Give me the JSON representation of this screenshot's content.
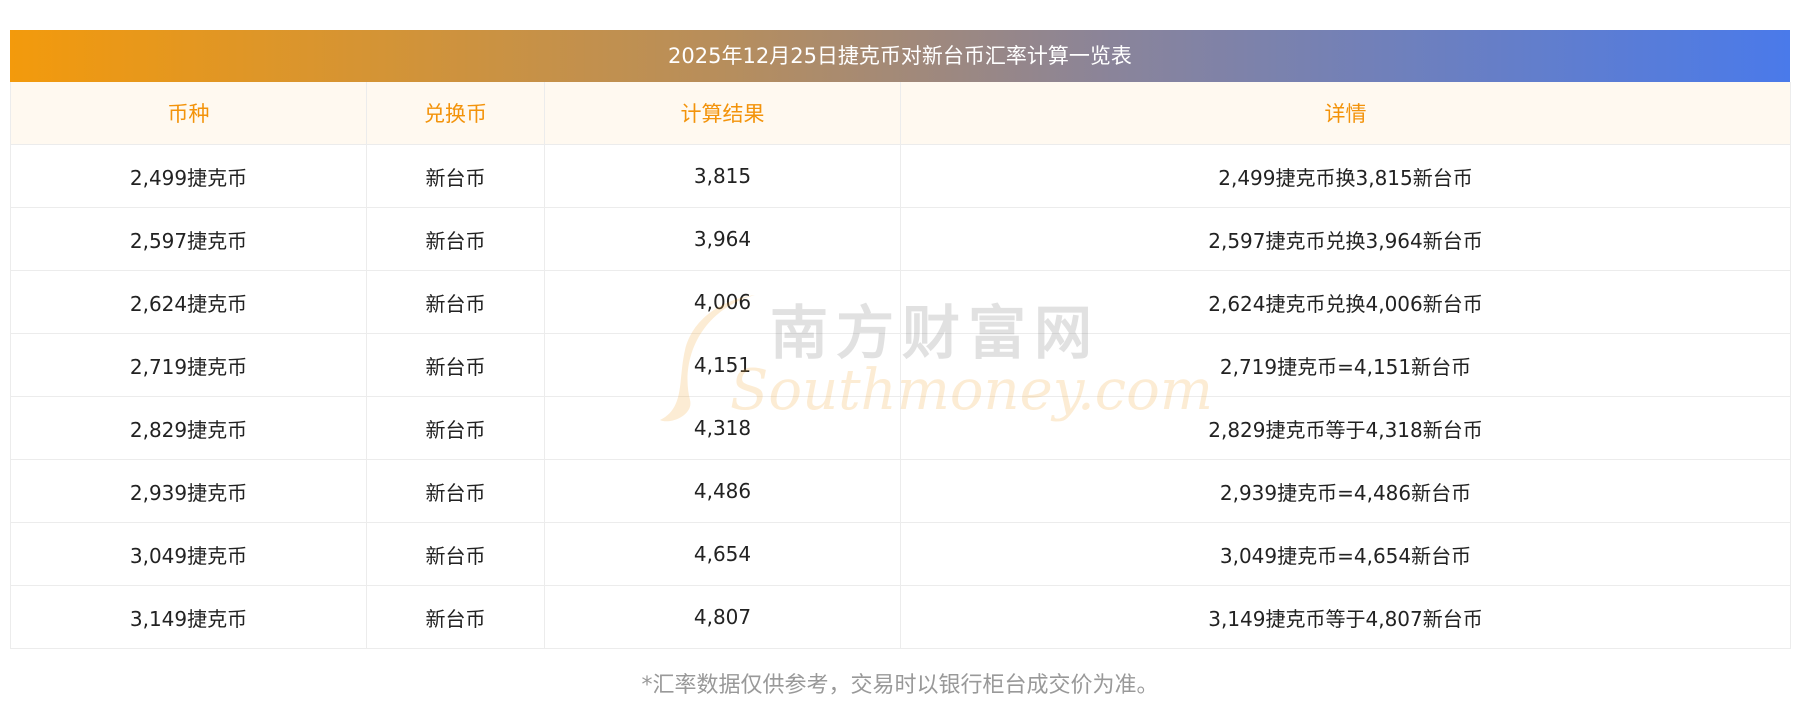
{
  "title": "2025年12月25日捷克币对新台币汇率计算一览表",
  "headers": [
    "币种",
    "兑换币",
    "计算结果",
    "详情"
  ],
  "rows": [
    [
      "2,499捷克币",
      "新台币",
      "3,815",
      "2,499捷克币换3,815新台币"
    ],
    [
      "2,597捷克币",
      "新台币",
      "3,964",
      "2,597捷克币兑换3,964新台币"
    ],
    [
      "2,624捷克币",
      "新台币",
      "4,006",
      "2,624捷克币兑换4,006新台币"
    ],
    [
      "2,719捷克币",
      "新台币",
      "4,151",
      "2,719捷克币=4,151新台币"
    ],
    [
      "2,829捷克币",
      "新台币",
      "4,318",
      "2,829捷克币等于4,318新台币"
    ],
    [
      "2,939捷克币",
      "新台币",
      "4,486",
      "2,939捷克币=4,486新台币"
    ],
    [
      "3,049捷克币",
      "新台币",
      "4,654",
      "3,049捷克币=4,654新台币"
    ],
    [
      "3,149捷克币",
      "新台币",
      "4,807",
      "3,149捷克币等于4,807新台币"
    ]
  ],
  "footnote": "*汇率数据仅供参考，交易时以银行柜台成交价为准。",
  "watermark": {
    "cn": "南方财富网",
    "en": "Southmoney.com"
  },
  "colors": {
    "gradient_start": "#f39a0c",
    "gradient_end": "#4a7aea",
    "header_text": "#f3930a",
    "header_bg": "#fff9f0",
    "footnote_text": "#999999"
  }
}
